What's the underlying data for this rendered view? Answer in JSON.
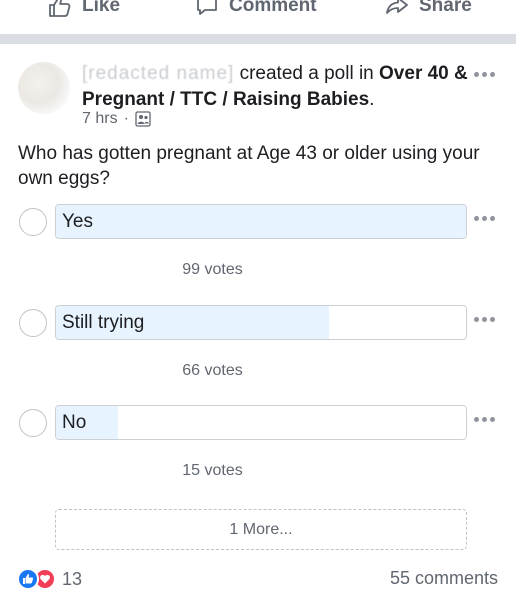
{
  "actions": {
    "like_label": "Like",
    "comment_label": "Comment",
    "share_label": "Share"
  },
  "post": {
    "author_name": "[redacted name]",
    "action_text": "created a poll in",
    "group_name": "Over 40 & Pregnant / TTC / Raising Babies",
    "group_suffix": ".",
    "time": "7 hrs",
    "privacy_icon": "group-members-icon",
    "question": "Who has gotten pregnant at Age 43 or older using your own eggs?"
  },
  "poll": {
    "options": [
      {
        "label": "Yes",
        "votes_text": "99 votes",
        "votes": 99,
        "fill_fraction": 1.0
      },
      {
        "label": "Still trying",
        "votes_text": "66 votes",
        "votes": 66,
        "fill_fraction": 0.667
      },
      {
        "label": "No",
        "votes_text": "15 votes",
        "votes": 15,
        "fill_fraction": 0.152
      }
    ],
    "more_label": "1 More..."
  },
  "footer": {
    "reaction_count": "13",
    "comments_text": "55 comments"
  },
  "colors": {
    "accent": "#1877f2",
    "love": "#f33e58",
    "bar_fill": "#e7f3ff",
    "separator": "#dadde1",
    "muted_text": "#606770"
  }
}
